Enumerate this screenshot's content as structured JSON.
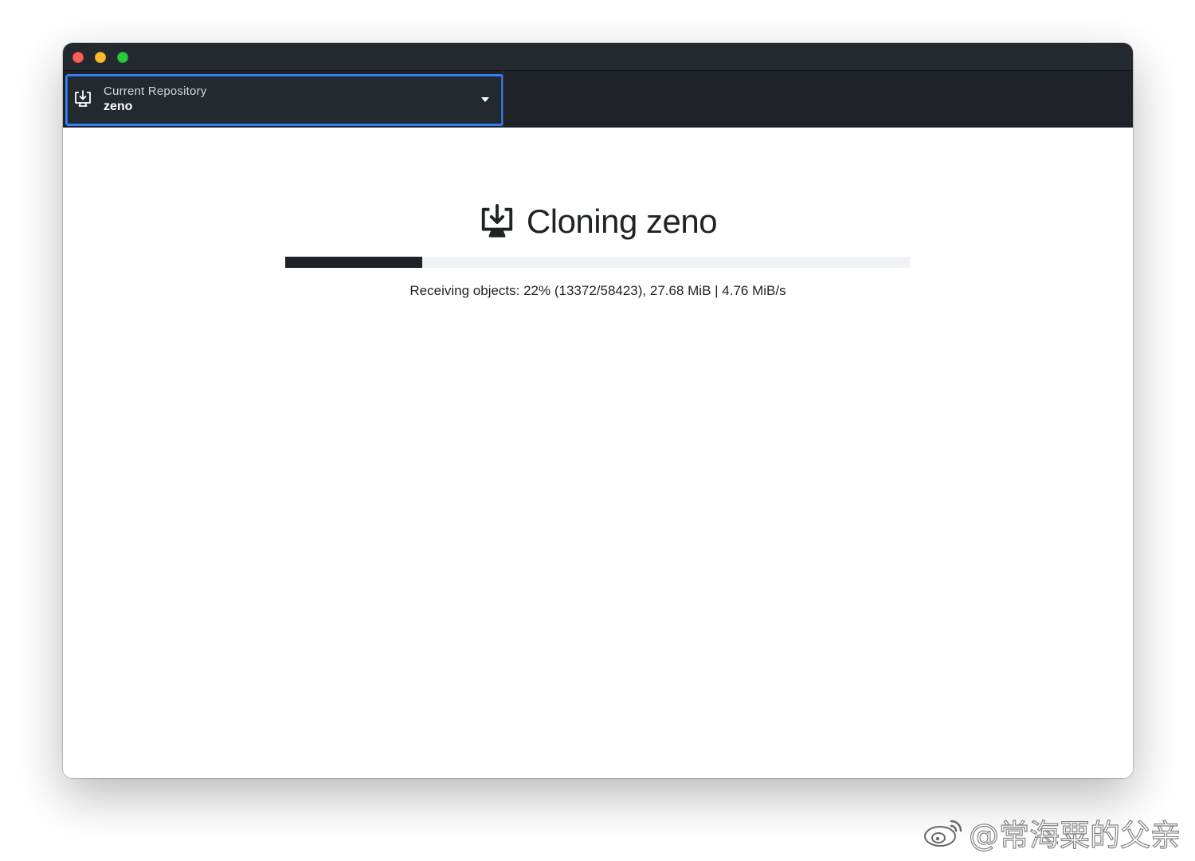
{
  "window": {
    "traffic_lights": {
      "close_color": "#fe5f57",
      "minimize_color": "#febc2e",
      "maximize_color": "#28c840"
    }
  },
  "toolbar": {
    "repository": {
      "label": "Current Repository",
      "name": "zeno",
      "icon": "repo-clone-icon"
    },
    "dropdown_icon": "chevron-down-icon"
  },
  "clone": {
    "title": "Cloning zeno",
    "icon": "repo-clone-icon",
    "progress_percent": 22,
    "status_text": "Receiving objects: 22% (13372/58423), 27.68 MiB | 4.76 MiB/s"
  },
  "colors": {
    "toolbar_bg": "#1f2328",
    "focus_ring": "#3b82f6",
    "progress_fill": "#1f2328",
    "progress_track": "#f0f2f5"
  },
  "watermark": {
    "text": "@常海粟的父亲",
    "icon": "weibo-icon"
  }
}
